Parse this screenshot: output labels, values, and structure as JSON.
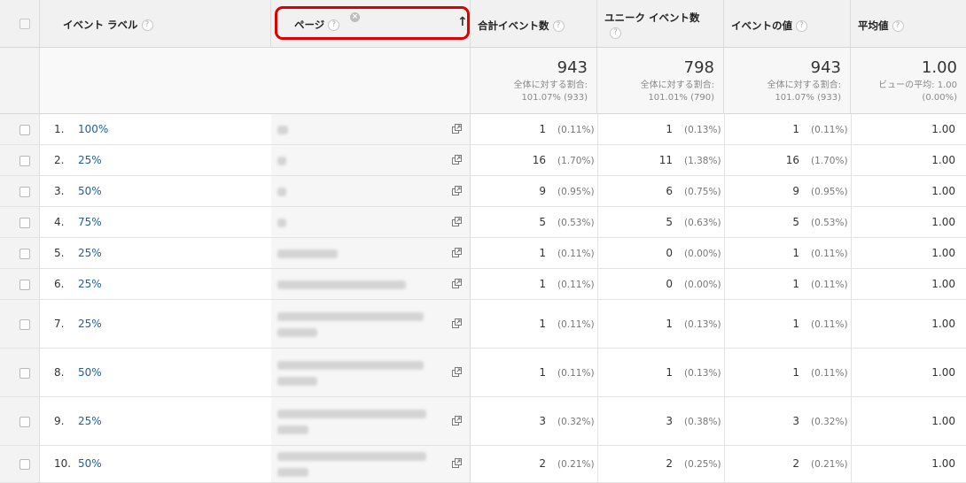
{
  "header": {
    "event_label": "イベント ラベル",
    "page": "ページ",
    "total_events": "合計イベント数",
    "unique_events": "ユニーク イベント数",
    "event_value": "イベントの値",
    "avg_value": "平均値",
    "help_glyph": "?",
    "remove_glyph": "×",
    "sort_glyph": "↑"
  },
  "summary": {
    "total_events": {
      "value": "943",
      "line1": "全体に対する割合:",
      "line2": "101.07% (933)"
    },
    "unique_events": {
      "value": "798",
      "line1": "全体に対する割合:",
      "line2": "101.01% (790)"
    },
    "event_value": {
      "value": "943",
      "line1": "全体に対する割合:",
      "line2": "101.07% (933)"
    },
    "avg_value": {
      "value": "1.00",
      "line1": "ビューの平均: 1.00",
      "line2": "(0.00%)"
    }
  },
  "rows": [
    {
      "num": "1.",
      "label": "100%",
      "total": "1",
      "total_pct": "(0.11%)",
      "unique": "1",
      "unique_pct": "(0.13%)",
      "value": "1",
      "value_pct": "(0.11%)",
      "avg": "1.00"
    },
    {
      "num": "2.",
      "label": "25%",
      "total": "16",
      "total_pct": "(1.70%)",
      "unique": "11",
      "unique_pct": "(1.38%)",
      "value": "16",
      "value_pct": "(1.70%)",
      "avg": "1.00"
    },
    {
      "num": "3.",
      "label": "50%",
      "total": "9",
      "total_pct": "(0.95%)",
      "unique": "6",
      "unique_pct": "(0.75%)",
      "value": "9",
      "value_pct": "(0.95%)",
      "avg": "1.00"
    },
    {
      "num": "4.",
      "label": "75%",
      "total": "5",
      "total_pct": "(0.53%)",
      "unique": "5",
      "unique_pct": "(0.63%)",
      "value": "5",
      "value_pct": "(0.53%)",
      "avg": "1.00"
    },
    {
      "num": "5.",
      "label": "25%",
      "total": "1",
      "total_pct": "(0.11%)",
      "unique": "0",
      "unique_pct": "(0.00%)",
      "value": "1",
      "value_pct": "(0.11%)",
      "avg": "1.00"
    },
    {
      "num": "6.",
      "label": "25%",
      "total": "1",
      "total_pct": "(0.11%)",
      "unique": "0",
      "unique_pct": "(0.00%)",
      "value": "1",
      "value_pct": "(0.11%)",
      "avg": "1.00"
    },
    {
      "num": "7.",
      "label": "25%",
      "total": "1",
      "total_pct": "(0.11%)",
      "unique": "1",
      "unique_pct": "(0.13%)",
      "value": "1",
      "value_pct": "(0.11%)",
      "avg": "1.00"
    },
    {
      "num": "8.",
      "label": "50%",
      "total": "1",
      "total_pct": "(0.11%)",
      "unique": "1",
      "unique_pct": "(0.13%)",
      "value": "1",
      "value_pct": "(0.11%)",
      "avg": "1.00"
    },
    {
      "num": "9.",
      "label": "25%",
      "total": "3",
      "total_pct": "(0.32%)",
      "unique": "3",
      "unique_pct": "(0.38%)",
      "value": "3",
      "value_pct": "(0.32%)",
      "avg": "1.00"
    },
    {
      "num": "10.",
      "label": "50%",
      "total": "2",
      "total_pct": "(0.21%)",
      "unique": "2",
      "unique_pct": "(0.25%)",
      "value": "2",
      "value_pct": "(0.21%)",
      "avg": "1.00"
    }
  ]
}
